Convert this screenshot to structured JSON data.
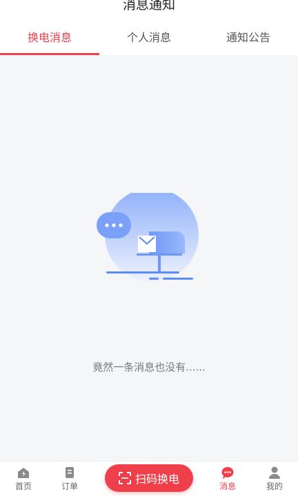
{
  "header": {
    "title": "消息通知",
    "tabs": [
      {
        "label": "换电消息"
      },
      {
        "label": "个人消息"
      },
      {
        "label": "通知公告"
      }
    ]
  },
  "empty_state": {
    "message": "竟然一条消息也没有......"
  },
  "bottom_nav": {
    "items": [
      {
        "label": "首页",
        "icon": "home-icon"
      },
      {
        "label": "订单",
        "icon": "order-icon"
      },
      {
        "label": "消息",
        "icon": "message-icon"
      },
      {
        "label": "我的",
        "icon": "profile-icon"
      }
    ],
    "scan_label": "扫码换电"
  },
  "colors": {
    "accent": "#ef3f4a",
    "illustration_blue": "#5b8cf5"
  }
}
